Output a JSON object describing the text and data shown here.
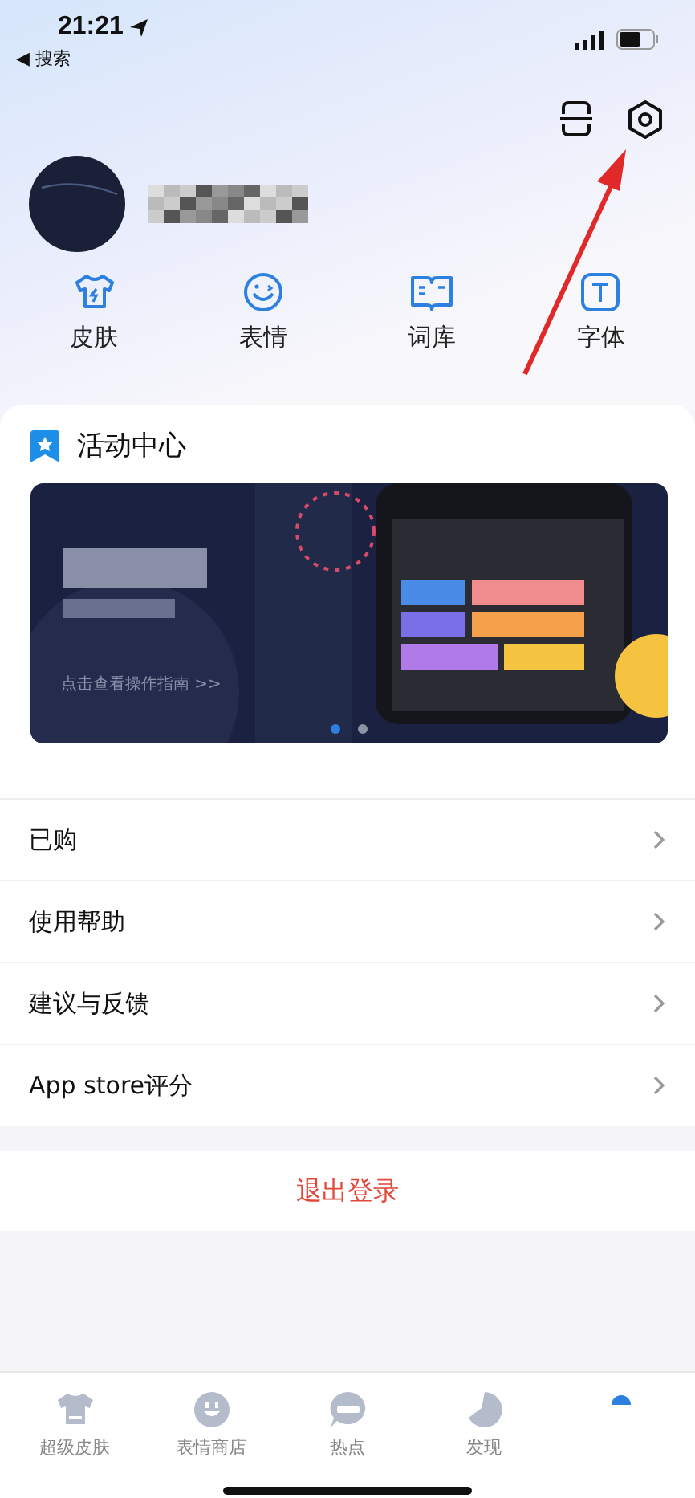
{
  "status_bar": {
    "time": "21:21",
    "back_label": "◀ 搜索"
  },
  "shortcuts": [
    {
      "kind": "shirt",
      "label": "皮肤"
    },
    {
      "kind": "smile",
      "label": "表情"
    },
    {
      "kind": "book",
      "label": "词库"
    },
    {
      "kind": "font",
      "label": "字体"
    }
  ],
  "activity": {
    "title": "活动中心",
    "banner": {
      "link": "点击查看操作指南 >>"
    },
    "dots": [
      {
        "selected": true
      },
      {
        "selected": false
      }
    ]
  },
  "menu": [
    {
      "label": "已购"
    },
    {
      "label": "使用帮助"
    },
    {
      "label": "建议与反馈"
    },
    {
      "label": "App store评分"
    }
  ],
  "logout": "退出登录",
  "tabs": [
    {
      "kind": "shirt",
      "label": "超级皮肤",
      "selected": false
    },
    {
      "kind": "smile",
      "label": "表情商店",
      "selected": false
    },
    {
      "kind": "hot",
      "label": "热点",
      "selected": false
    },
    {
      "kind": "discover",
      "label": "发现",
      "selected": false
    },
    {
      "kind": "me",
      "selected": true
    }
  ]
}
